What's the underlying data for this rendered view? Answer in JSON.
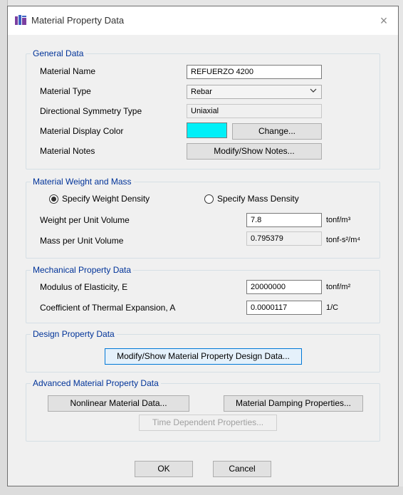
{
  "dialog": {
    "title": "Material Property Data",
    "close_glyph": "×"
  },
  "general": {
    "legend": "General Data",
    "material_name_label": "Material Name",
    "material_name_value": "REFUERZO 4200",
    "material_type_label": "Material Type",
    "material_type_value": "Rebar",
    "symmetry_label": "Directional Symmetry Type",
    "symmetry_value": "Uniaxial",
    "display_color_label": "Material Display Color",
    "display_color": "#00f0f8",
    "change_label": "Change...",
    "notes_label": "Material Notes",
    "notes_button": "Modify/Show Notes..."
  },
  "weight": {
    "legend": "Material Weight and Mass",
    "specify_weight_label": "Specify Weight Density",
    "specify_mass_label": "Specify Mass Density",
    "selected": "weight",
    "weight_label": "Weight per Unit Volume",
    "weight_value": "7.8",
    "weight_unit": "tonf/m³",
    "mass_label": "Mass per Unit Volume",
    "mass_value": "0.795379",
    "mass_unit": "tonf-s²/m⁴"
  },
  "mechanical": {
    "legend": "Mechanical Property Data",
    "modulus_label": "Modulus of Elasticity,  E",
    "modulus_value": "20000000",
    "modulus_unit": "tonf/m²",
    "thermal_label": "Coefficient of Thermal Expansion,  A",
    "thermal_value": "0.0000117",
    "thermal_unit": "1/C"
  },
  "design": {
    "legend": "Design Property Data",
    "button": "Modify/Show Material Property Design Data..."
  },
  "advanced": {
    "legend": "Advanced Material Property Data",
    "nonlinear_button": "Nonlinear Material Data...",
    "damping_button": "Material Damping Properties...",
    "time_button": "Time Dependent Properties..."
  },
  "footer": {
    "ok": "OK",
    "cancel": "Cancel"
  }
}
